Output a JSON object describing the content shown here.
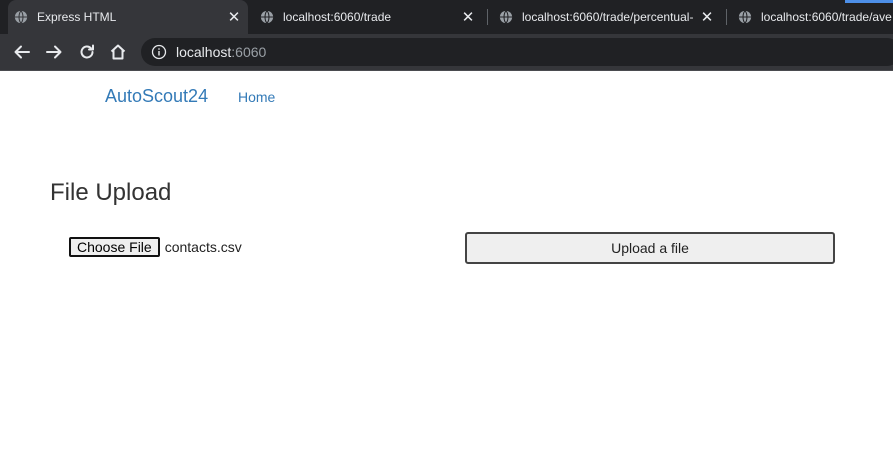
{
  "browser": {
    "tabs": [
      {
        "title": "Express HTML",
        "active": true
      },
      {
        "title": "localhost:6060/trade",
        "active": false
      },
      {
        "title": "localhost:6060/trade/percentual-",
        "active": false
      },
      {
        "title": "localhost:6060/trade/ave",
        "active": false
      }
    ],
    "address": {
      "host": "localhost",
      "port": ":6060"
    }
  },
  "page": {
    "brand": "AutoScout24",
    "nav_home": "Home",
    "heading": "File Upload",
    "choose_file_label": "Choose File",
    "file_name": "contacts.csv",
    "upload_label": "Upload a file"
  },
  "colors": {
    "link": "#337ab7",
    "chrome_dark": "#202124",
    "chrome_toolbar": "#35363a"
  }
}
